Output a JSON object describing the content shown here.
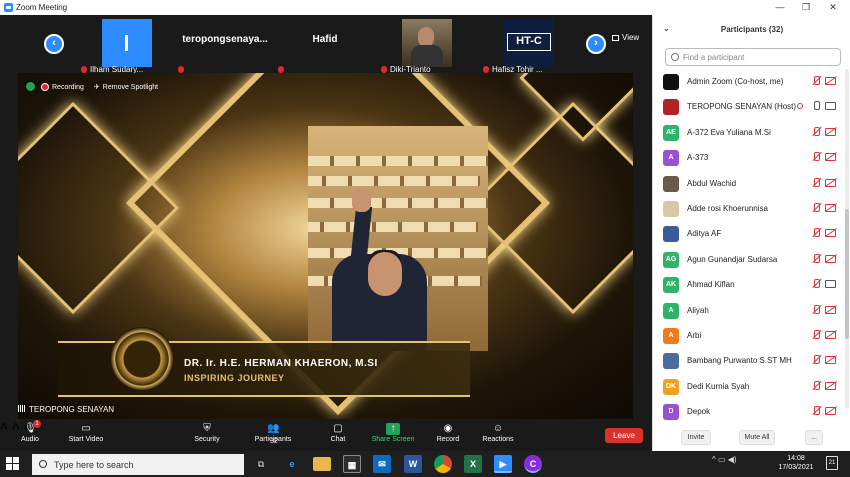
{
  "window": {
    "title": "Zoom Meeting",
    "minimize": "—",
    "maximize": "❐",
    "close": "✕"
  },
  "strip": {
    "view_label": "View",
    "tiles": [
      {
        "label": "Ilham Sudary...",
        "name": ""
      },
      {
        "label": "",
        "name": "teropongsenaya..."
      },
      {
        "label": "",
        "name": "Hafid"
      },
      {
        "label": "Diki-Trianto",
        "name": ""
      },
      {
        "label": "Hafisz Tohir ...",
        "name": "",
        "logo": "HT-C"
      }
    ]
  },
  "video": {
    "recording": "Recording",
    "remove_spotlight": "Remove Spotlight",
    "banner_name": "DR. Ir. H.E. HERMAN KHAERON, M.SI",
    "banner_sub": "INSPIRING JOURNEY",
    "speaker": "TEROPONG SENAYAN"
  },
  "toolbar": {
    "audio": "Audio",
    "start_video": "Start Video",
    "security": "Security",
    "participants": "Participants",
    "participants_count": "32",
    "chat": "Chat",
    "share_screen": "Share Screen",
    "record": "Record",
    "reactions": "Reactions",
    "leave": "Leave",
    "audio_badge": "1"
  },
  "panel": {
    "title": "Participants (32)",
    "search_placeholder": "Find a participant",
    "participants": [
      {
        "name": "Admin Zoom (Co-host, me)",
        "avatar": "",
        "color": "#111111",
        "mic": "muted",
        "cam": "off"
      },
      {
        "name": "TEROPONG SENAYAN (Host)",
        "avatar": "",
        "color": "#b22222",
        "mic": "on",
        "cam": "on",
        "recording": true
      },
      {
        "name": "A-372 Eva Yuliana M.Si",
        "avatar": "AE",
        "color": "#2fb36a",
        "mic": "muted",
        "cam": "off"
      },
      {
        "name": "A-373",
        "avatar": "A",
        "color": "#9b4fd1",
        "mic": "muted",
        "cam": "off"
      },
      {
        "name": "Abdul Wachid",
        "avatar": "",
        "color": "#6b5a4a",
        "mic": "muted",
        "cam": "off"
      },
      {
        "name": "Adde rosi Khoerunnisa",
        "avatar": "",
        "color": "#d8c8a8",
        "mic": "muted",
        "cam": "off"
      },
      {
        "name": "Aditya AF",
        "avatar": "",
        "color": "#3a5a9a",
        "mic": "muted",
        "cam": "off"
      },
      {
        "name": "Agun Gunandjar Sudarsa",
        "avatar": "AG",
        "color": "#2fb36a",
        "mic": "muted",
        "cam": "off"
      },
      {
        "name": "Ahmad Kiflan",
        "avatar": "AK",
        "color": "#2fb36a",
        "mic": "muted",
        "cam": "on"
      },
      {
        "name": "Aliyah",
        "avatar": "A",
        "color": "#2fb36a",
        "mic": "muted",
        "cam": "off"
      },
      {
        "name": "Arbi",
        "avatar": "A",
        "color": "#f07a1a",
        "mic": "muted",
        "cam": "off"
      },
      {
        "name": "Bambang Purwanto S.ST MH",
        "avatar": "",
        "color": "#4a6aa0",
        "mic": "muted",
        "cam": "off"
      },
      {
        "name": "Dedi Kurnia Syah",
        "avatar": "DK",
        "color": "#f0a020",
        "mic": "muted",
        "cam": "off"
      },
      {
        "name": "Depok",
        "avatar": "D",
        "color": "#9b4fd1",
        "mic": "muted",
        "cam": "off"
      }
    ],
    "invite": "Invite",
    "mute_all": "Mute All",
    "more": "..."
  },
  "taskbar": {
    "search_placeholder": "Type here to search",
    "time": "14:08",
    "date": "17/03/2021",
    "notif_count": "21",
    "tray": "^  ▭  ◀)"
  }
}
